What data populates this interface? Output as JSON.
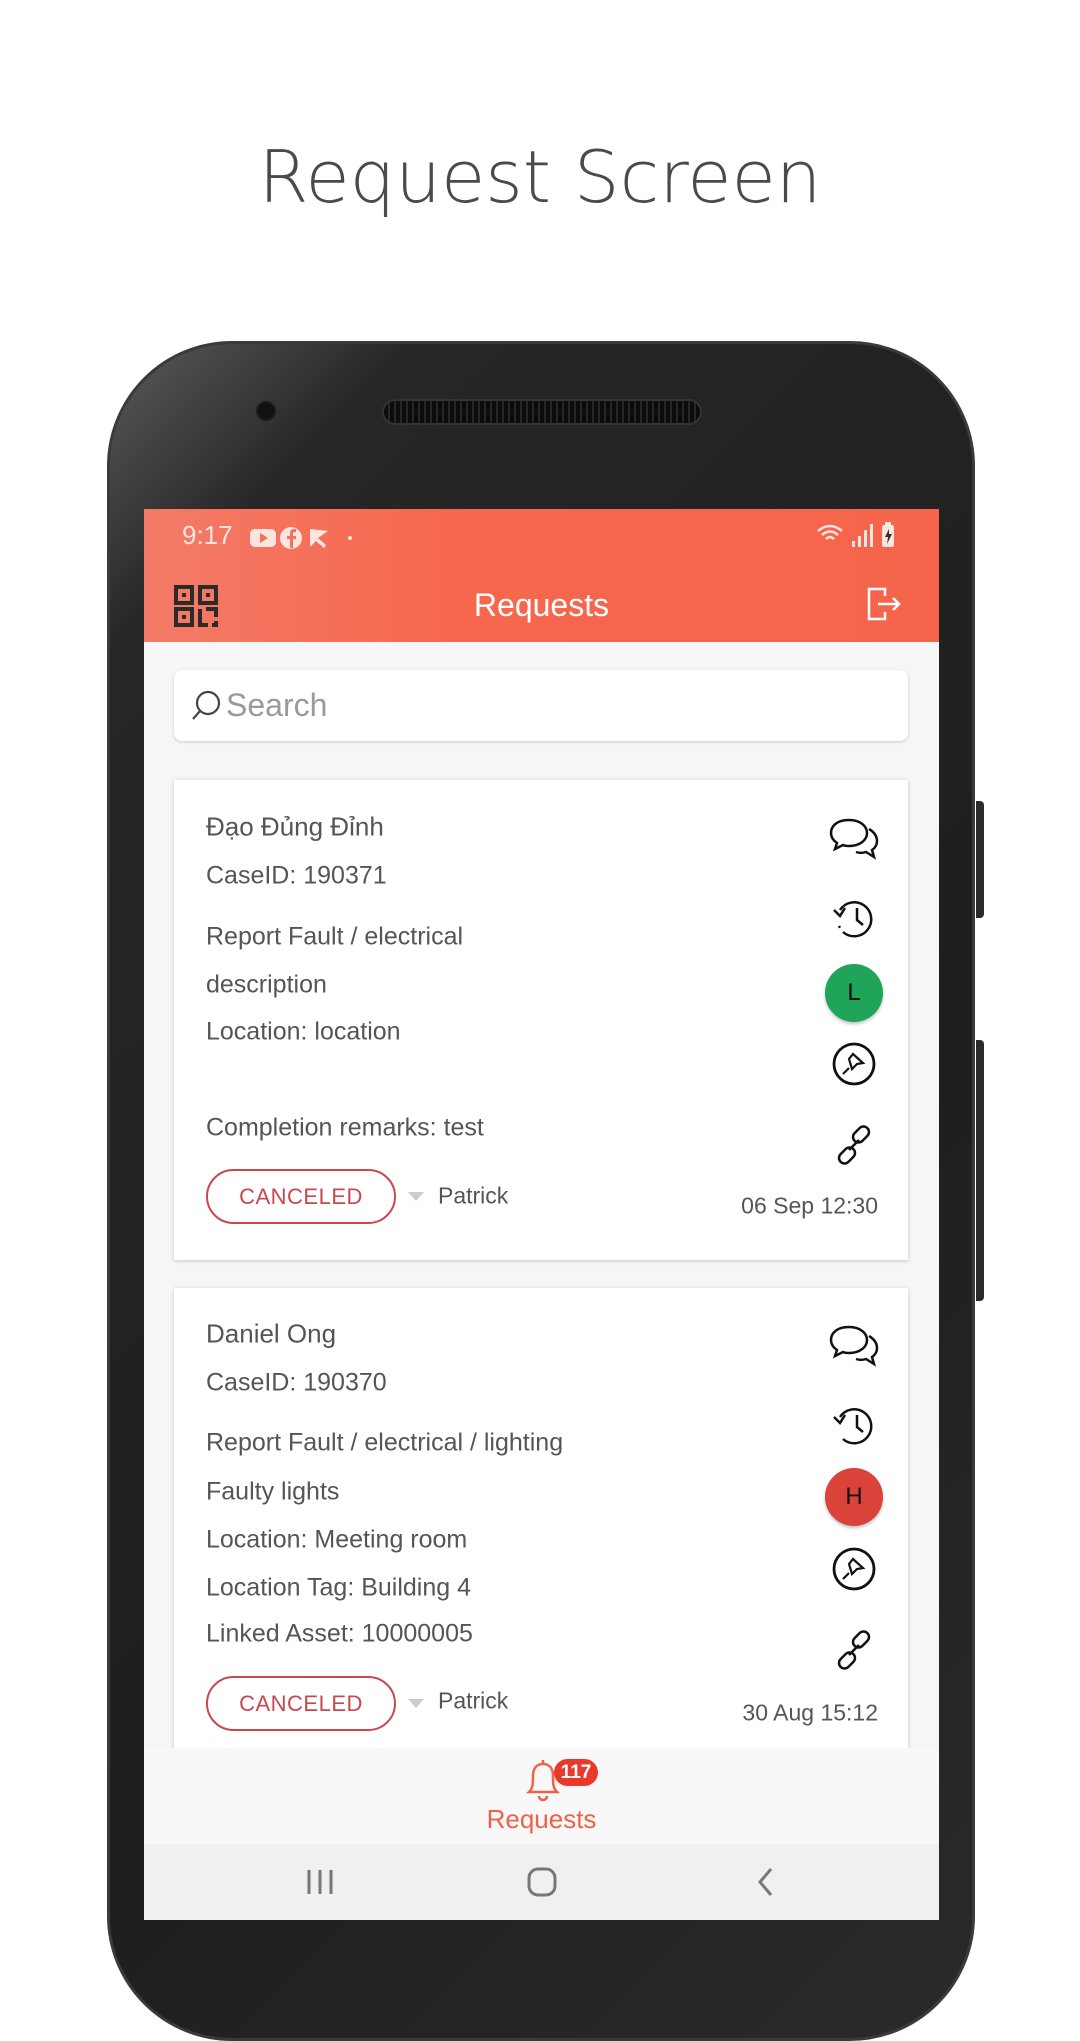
{
  "page_title": "Request Screen",
  "status_bar": {
    "time": "9:17",
    "icons": [
      "youtube-icon",
      "facebook-icon",
      "play-store-icon",
      "dot-icon"
    ],
    "right_icons": [
      "wifi-icon",
      "signal-icon",
      "battery-charging-icon"
    ]
  },
  "app_bar": {
    "title": "Requests",
    "left_icon": "qr-code-icon",
    "right_icon": "logout-icon"
  },
  "search": {
    "placeholder": "Search"
  },
  "colors": {
    "accent": "#f6674d",
    "canceled": "#c9474f",
    "priority_low": "#1fa45a",
    "priority_high": "#d9433a",
    "badge": "#e8392a"
  },
  "requests": [
    {
      "name": "Đạo Đủng Đỉnh",
      "case_id": "CaseID: 190371",
      "category": "Report Fault / electrical",
      "description": "description",
      "location": "Location: location",
      "remarks": "Completion remarks: test",
      "status": "CANCELED",
      "assignee": "Patrick",
      "date": "06 Sep 12:30",
      "priority": "L"
    },
    {
      "name": "Daniel Ong",
      "case_id": "CaseID: 190370",
      "category": "Report Fault / electrical / lighting",
      "description": "Faulty lights",
      "location": "Location: Meeting room",
      "location_tag": "Location Tag: Building 4",
      "linked_asset": "Linked Asset: 10000005",
      "status": "CANCELED",
      "assignee": "Patrick",
      "date": "30 Aug 15:12",
      "priority": "H"
    }
  ],
  "bottom_nav": {
    "label": "Requests",
    "badge": "117",
    "icon": "bell-icon"
  },
  "system_nav": [
    "recents-icon",
    "home-icon",
    "back-icon"
  ]
}
